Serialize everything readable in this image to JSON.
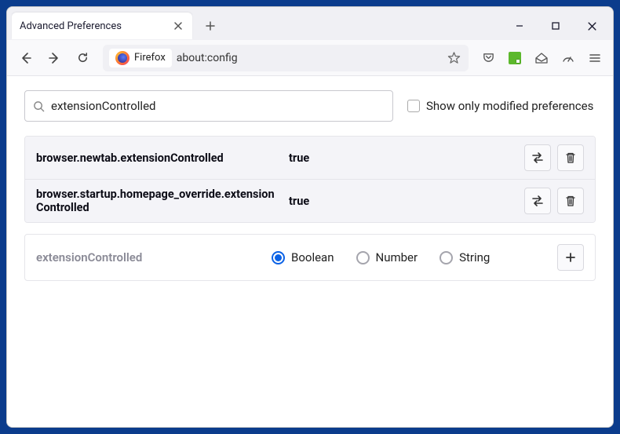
{
  "window": {
    "tab_title": "Advanced Preferences"
  },
  "toolbar": {
    "identity": "Firefox",
    "url": "about:config"
  },
  "search": {
    "value": "extensionControlled",
    "checkbox_label": "Show only modified preferences"
  },
  "results": [
    {
      "name": "browser.newtab.extensionControlled",
      "value": "true"
    },
    {
      "name": "browser.startup.homepage_override.extensionControlled",
      "value": "true"
    }
  ],
  "new_pref": {
    "name": "extensionControlled",
    "types": [
      "Boolean",
      "Number",
      "String"
    ],
    "selected": "Boolean"
  }
}
